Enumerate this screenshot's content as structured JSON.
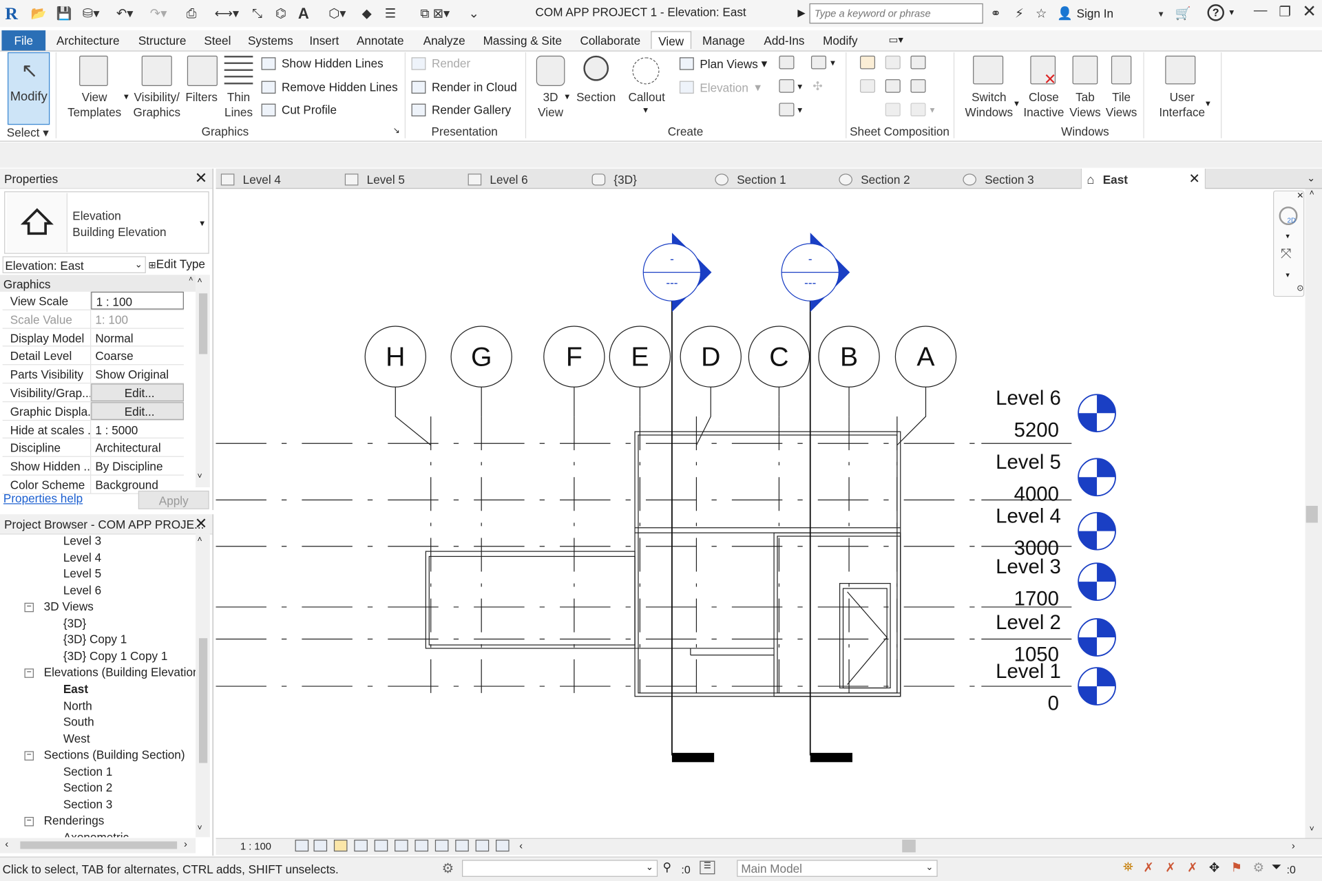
{
  "app": {
    "logo": "R",
    "title": "COM APP PROJECT 1 - Elevation: East",
    "search_placeholder": "Type a keyword or phrase",
    "sign_in": "Sign In",
    "help": "?"
  },
  "qat_icons": [
    "open-icon",
    "save-icon",
    "sync-icon",
    "undo-icon",
    "redo-icon",
    "print-icon",
    "measure-icon",
    "dimension-icon",
    "tag-icon",
    "text-icon",
    "3d-view-icon",
    "section-icon",
    "thin-lines-icon",
    "switch-windows-icon",
    "dropdown-icon"
  ],
  "menus": [
    "File",
    "Architecture",
    "Structure",
    "Steel",
    "Systems",
    "Insert",
    "Annotate",
    "Analyze",
    "Massing & Site",
    "Collaborate",
    "View",
    "Manage",
    "Add-Ins",
    "Modify"
  ],
  "ribbon": {
    "modify": "Modify",
    "select": "Select",
    "view_templates": "View\nTemplates",
    "visibility_graphics": "Visibility/\nGraphics",
    "filters": "Filters",
    "thin_lines": "Thin\nLines",
    "show_hidden": "Show  Hidden Lines",
    "remove_hidden": "Remove  Hidden Lines",
    "cut_profile": "Cut  Profile",
    "graphics_panel": "Graphics",
    "render": "Render",
    "render_cloud": "Render  in Cloud",
    "render_gallery": "Render  Gallery",
    "presentation_panel": "Presentation",
    "view3d": "3D\nView",
    "section": "Section",
    "callout": "Callout",
    "plan_views": "Plan  Views",
    "elevation": "Elevation",
    "create_panel": "Create",
    "sheet_panel": "Sheet Composition",
    "switch_windows": "Switch\nWindows",
    "close_inactive": "Close\nInactive",
    "tab_views": "Tab\nViews",
    "tile_views": "Tile\nViews",
    "user_interface": "User\nInterface",
    "windows_panel": "Windows"
  },
  "properties": {
    "title": "Properties",
    "type_line1": "Elevation",
    "type_line2": "Building Elevation",
    "selector": "Elevation: East",
    "edit_type": "Edit Type",
    "group": "Graphics",
    "rows": [
      {
        "k": "View Scale",
        "v": "1 : 100"
      },
      {
        "k": "Scale Value",
        "v": "1:  100"
      },
      {
        "k": "Display Model",
        "v": "Normal"
      },
      {
        "k": "Detail Level",
        "v": "Coarse"
      },
      {
        "k": "Parts Visibility",
        "v": "Show Original"
      },
      {
        "k": "Visibility/Grap...",
        "v": "Edit..."
      },
      {
        "k": "Graphic Displa...",
        "v": "Edit..."
      },
      {
        "k": "Hide at scales ...",
        "v": "1 : 5000"
      },
      {
        "k": "Discipline",
        "v": "Architectural"
      },
      {
        "k": "Show Hidden ...",
        "v": "By Discipline"
      },
      {
        "k": "Color Scheme",
        "v": "Background"
      }
    ],
    "help": "Properties help",
    "apply": "Apply"
  },
  "browser": {
    "title": "Project Browser - COM APP PROJE...",
    "items": [
      {
        "t": "Level 3",
        "lvl": 2
      },
      {
        "t": "Level 4",
        "lvl": 2
      },
      {
        "t": "Level 5",
        "lvl": 2
      },
      {
        "t": "Level 6",
        "lvl": 2
      },
      {
        "t": "3D Views",
        "lvl": 1
      },
      {
        "t": "{3D}",
        "lvl": 2
      },
      {
        "t": "{3D} Copy 1",
        "lvl": 2
      },
      {
        "t": "{3D} Copy 1 Copy 1",
        "lvl": 2
      },
      {
        "t": "Elevations (Building Elevation",
        "lvl": 1
      },
      {
        "t": "East",
        "lvl": 2
      },
      {
        "t": "North",
        "lvl": 2
      },
      {
        "t": "South",
        "lvl": 2
      },
      {
        "t": "West",
        "lvl": 2
      },
      {
        "t": "Sections (Building Section)",
        "lvl": 1
      },
      {
        "t": "Section 1",
        "lvl": 2
      },
      {
        "t": "Section 2",
        "lvl": 2
      },
      {
        "t": "Section 3",
        "lvl": 2
      },
      {
        "t": "Renderings",
        "lvl": 1
      },
      {
        "t": "Axonometric",
        "lvl": 2
      }
    ]
  },
  "tabs": [
    "Level 4",
    "Level 5",
    "Level 6",
    "{3D}",
    "Section 1",
    "Section 2",
    "Section 3",
    "East"
  ],
  "drawing": {
    "grids": [
      "H",
      "G",
      "F",
      "E",
      "D",
      "C",
      "B",
      "A"
    ],
    "levels": [
      {
        "name": "Level 6",
        "elev": "5200"
      },
      {
        "name": "Level 5",
        "elev": "4000"
      },
      {
        "name": "Level 4",
        "elev": "3000"
      },
      {
        "name": "Level 3",
        "elev": "1700"
      },
      {
        "name": "Level 2",
        "elev": "1050"
      },
      {
        "name": "Level 1",
        "elev": "0"
      }
    ],
    "section_head_top": "-",
    "section_head_bottom": "---",
    "accent": "#1a3fc4"
  },
  "view_bar": {
    "scale": "1 : 100"
  },
  "status": {
    "text": "Click to select, TAB for alternates, CTRL adds, SHIFT unselects.",
    "count1": ":0",
    "model": "Main Model",
    "count2": ":0"
  }
}
